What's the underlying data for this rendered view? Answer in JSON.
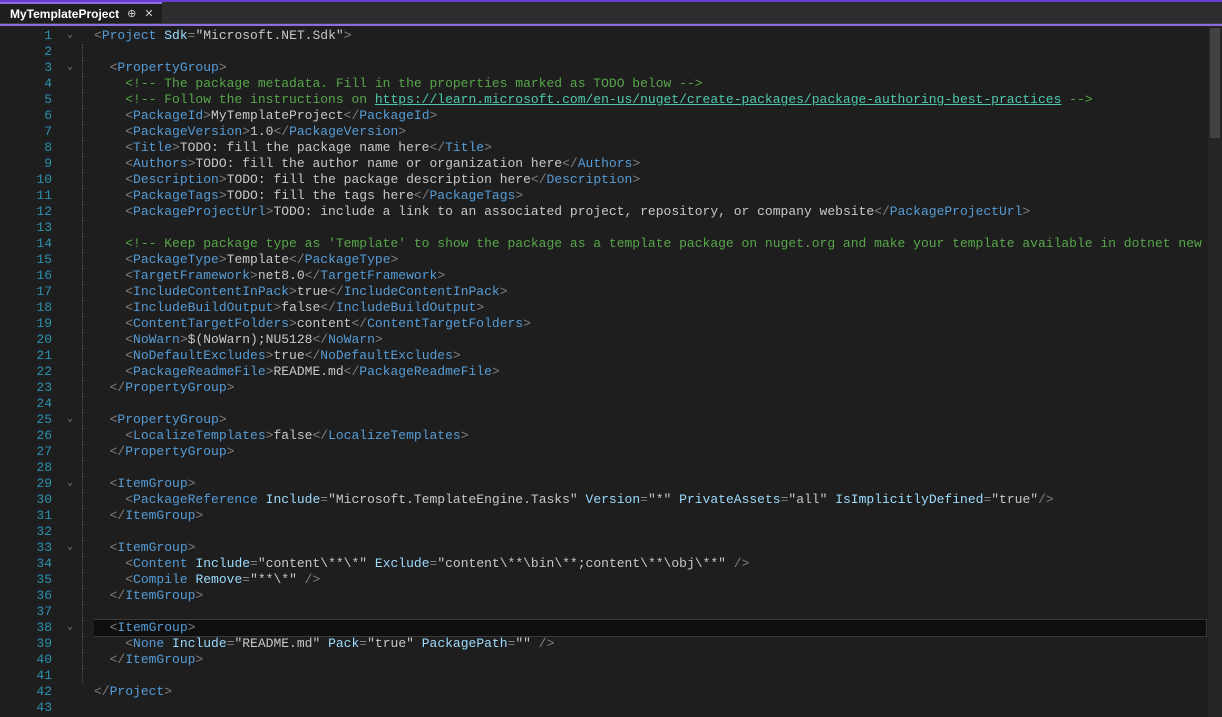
{
  "tab": {
    "title": "MyTemplateProject"
  },
  "line_count": 43,
  "fold": {
    "1": "v",
    "3": "v",
    "25": "v",
    "26": "",
    "29": "v",
    "33": "v",
    "38": "v"
  },
  "highlighted_line": 38,
  "lines": [
    {
      "n": 1,
      "chunks": [
        [
          "p",
          "<"
        ],
        [
          "t",
          "Project "
        ],
        [
          "a",
          "Sdk"
        ],
        [
          "p",
          "="
        ],
        [
          "s",
          "\"Microsoft.NET.Sdk\""
        ],
        [
          "p",
          ">"
        ]
      ]
    },
    {
      "n": 2,
      "chunks": []
    },
    {
      "n": 3,
      "chunks": [
        [
          "p",
          "  <"
        ],
        [
          "t",
          "PropertyGroup"
        ],
        [
          "p",
          ">"
        ]
      ]
    },
    {
      "n": 4,
      "chunks": [
        [
          "p",
          "    "
        ],
        [
          "c",
          "<!-- The package metadata. Fill in the properties marked as TODO below -->"
        ]
      ]
    },
    {
      "n": 5,
      "chunks": [
        [
          "p",
          "    "
        ],
        [
          "c",
          "<!-- Follow the instructions on "
        ],
        [
          "lk",
          "https://learn.microsoft.com/en-us/nuget/create-packages/package-authoring-best-practices"
        ],
        [
          "c",
          " -->"
        ]
      ]
    },
    {
      "n": 6,
      "chunks": [
        [
          "p",
          "    <"
        ],
        [
          "t",
          "PackageId"
        ],
        [
          "p",
          ">"
        ],
        [
          "tx",
          "MyTemplateProject"
        ],
        [
          "p",
          "</"
        ],
        [
          "t",
          "PackageId"
        ],
        [
          "p",
          ">"
        ]
      ]
    },
    {
      "n": 7,
      "chunks": [
        [
          "p",
          "    <"
        ],
        [
          "t",
          "PackageVersion"
        ],
        [
          "p",
          ">"
        ],
        [
          "tx",
          "1.0"
        ],
        [
          "p",
          "</"
        ],
        [
          "t",
          "PackageVersion"
        ],
        [
          "p",
          ">"
        ]
      ]
    },
    {
      "n": 8,
      "chunks": [
        [
          "p",
          "    <"
        ],
        [
          "t",
          "Title"
        ],
        [
          "p",
          ">"
        ],
        [
          "tx",
          "TODO: fill the package name here"
        ],
        [
          "p",
          "</"
        ],
        [
          "t",
          "Title"
        ],
        [
          "p",
          ">"
        ]
      ]
    },
    {
      "n": 9,
      "chunks": [
        [
          "p",
          "    <"
        ],
        [
          "t",
          "Authors"
        ],
        [
          "p",
          ">"
        ],
        [
          "tx",
          "TODO: fill the author name or organization here"
        ],
        [
          "p",
          "</"
        ],
        [
          "t",
          "Authors"
        ],
        [
          "p",
          ">"
        ]
      ]
    },
    {
      "n": 10,
      "chunks": [
        [
          "p",
          "    <"
        ],
        [
          "t",
          "Description"
        ],
        [
          "p",
          ">"
        ],
        [
          "tx",
          "TODO: fill the package description here"
        ],
        [
          "p",
          "</"
        ],
        [
          "t",
          "Description"
        ],
        [
          "p",
          ">"
        ]
      ]
    },
    {
      "n": 11,
      "chunks": [
        [
          "p",
          "    <"
        ],
        [
          "t",
          "PackageTags"
        ],
        [
          "p",
          ">"
        ],
        [
          "tx",
          "TODO: fill the tags here"
        ],
        [
          "p",
          "</"
        ],
        [
          "t",
          "PackageTags"
        ],
        [
          "p",
          ">"
        ]
      ]
    },
    {
      "n": 12,
      "chunks": [
        [
          "p",
          "    <"
        ],
        [
          "t",
          "PackageProjectUrl"
        ],
        [
          "p",
          ">"
        ],
        [
          "tx",
          "TODO: include a link to an associated project, repository, or company website"
        ],
        [
          "p",
          "</"
        ],
        [
          "t",
          "PackageProjectUrl"
        ],
        [
          "p",
          ">"
        ]
      ]
    },
    {
      "n": 13,
      "chunks": []
    },
    {
      "n": 14,
      "chunks": [
        [
          "p",
          "    "
        ],
        [
          "c",
          "<!-- Keep package type as 'Template' to show the package as a template package on nuget.org and make your template available in dotnet new search.-->"
        ]
      ]
    },
    {
      "n": 15,
      "chunks": [
        [
          "p",
          "    <"
        ],
        [
          "t",
          "PackageType"
        ],
        [
          "p",
          ">"
        ],
        [
          "tx",
          "Template"
        ],
        [
          "p",
          "</"
        ],
        [
          "t",
          "PackageType"
        ],
        [
          "p",
          ">"
        ]
      ]
    },
    {
      "n": 16,
      "chunks": [
        [
          "p",
          "    <"
        ],
        [
          "t",
          "TargetFramework"
        ],
        [
          "p",
          ">"
        ],
        [
          "tx",
          "net8.0"
        ],
        [
          "p",
          "</"
        ],
        [
          "t",
          "TargetFramework"
        ],
        [
          "p",
          ">"
        ]
      ]
    },
    {
      "n": 17,
      "chunks": [
        [
          "p",
          "    <"
        ],
        [
          "t",
          "IncludeContentInPack"
        ],
        [
          "p",
          ">"
        ],
        [
          "tx",
          "true"
        ],
        [
          "p",
          "</"
        ],
        [
          "t",
          "IncludeContentInPack"
        ],
        [
          "p",
          ">"
        ]
      ]
    },
    {
      "n": 18,
      "chunks": [
        [
          "p",
          "    <"
        ],
        [
          "t",
          "IncludeBuildOutput"
        ],
        [
          "p",
          ">"
        ],
        [
          "tx",
          "false"
        ],
        [
          "p",
          "</"
        ],
        [
          "t",
          "IncludeBuildOutput"
        ],
        [
          "p",
          ">"
        ]
      ]
    },
    {
      "n": 19,
      "chunks": [
        [
          "p",
          "    <"
        ],
        [
          "t",
          "ContentTargetFolders"
        ],
        [
          "p",
          ">"
        ],
        [
          "tx",
          "content"
        ],
        [
          "p",
          "</"
        ],
        [
          "t",
          "ContentTargetFolders"
        ],
        [
          "p",
          ">"
        ]
      ]
    },
    {
      "n": 20,
      "chunks": [
        [
          "p",
          "    <"
        ],
        [
          "t",
          "NoWarn"
        ],
        [
          "p",
          ">"
        ],
        [
          "tx",
          "$(NoWarn);NU5128"
        ],
        [
          "p",
          "</"
        ],
        [
          "t",
          "NoWarn"
        ],
        [
          "p",
          ">"
        ]
      ]
    },
    {
      "n": 21,
      "chunks": [
        [
          "p",
          "    <"
        ],
        [
          "t",
          "NoDefaultExcludes"
        ],
        [
          "p",
          ">"
        ],
        [
          "tx",
          "true"
        ],
        [
          "p",
          "</"
        ],
        [
          "t",
          "NoDefaultExcludes"
        ],
        [
          "p",
          ">"
        ]
      ]
    },
    {
      "n": 22,
      "chunks": [
        [
          "p",
          "    <"
        ],
        [
          "t",
          "PackageReadmeFile"
        ],
        [
          "p",
          ">"
        ],
        [
          "tx",
          "README.md"
        ],
        [
          "p",
          "</"
        ],
        [
          "t",
          "PackageReadmeFile"
        ],
        [
          "p",
          ">"
        ]
      ]
    },
    {
      "n": 23,
      "chunks": [
        [
          "p",
          "  </"
        ],
        [
          "t",
          "PropertyGroup"
        ],
        [
          "p",
          ">"
        ]
      ]
    },
    {
      "n": 24,
      "chunks": []
    },
    {
      "n": 25,
      "chunks": [
        [
          "p",
          "  <"
        ],
        [
          "t",
          "PropertyGroup"
        ],
        [
          "p",
          ">"
        ]
      ]
    },
    {
      "n": 26,
      "chunks": [
        [
          "p",
          "    <"
        ],
        [
          "t",
          "LocalizeTemplates"
        ],
        [
          "p",
          ">"
        ],
        [
          "tx",
          "false"
        ],
        [
          "p",
          "</"
        ],
        [
          "t",
          "LocalizeTemplates"
        ],
        [
          "p",
          ">"
        ]
      ]
    },
    {
      "n": 27,
      "chunks": [
        [
          "p",
          "  </"
        ],
        [
          "t",
          "PropertyGroup"
        ],
        [
          "p",
          ">"
        ]
      ]
    },
    {
      "n": 28,
      "chunks": []
    },
    {
      "n": 29,
      "chunks": [
        [
          "p",
          "  <"
        ],
        [
          "t",
          "ItemGroup"
        ],
        [
          "p",
          ">"
        ]
      ]
    },
    {
      "n": 30,
      "chunks": [
        [
          "p",
          "    <"
        ],
        [
          "t",
          "PackageReference "
        ],
        [
          "a",
          "Include"
        ],
        [
          "p",
          "="
        ],
        [
          "s",
          "\"Microsoft.TemplateEngine.Tasks\" "
        ],
        [
          "a",
          "Version"
        ],
        [
          "p",
          "="
        ],
        [
          "s",
          "\"*\" "
        ],
        [
          "a",
          "PrivateAssets"
        ],
        [
          "p",
          "="
        ],
        [
          "s",
          "\"all\" "
        ],
        [
          "a",
          "IsImplicitlyDefined"
        ],
        [
          "p",
          "="
        ],
        [
          "s",
          "\"true\""
        ],
        [
          "p",
          "/>"
        ]
      ]
    },
    {
      "n": 31,
      "chunks": [
        [
          "p",
          "  </"
        ],
        [
          "t",
          "ItemGroup"
        ],
        [
          "p",
          ">"
        ]
      ]
    },
    {
      "n": 32,
      "chunks": []
    },
    {
      "n": 33,
      "chunks": [
        [
          "p",
          "  <"
        ],
        [
          "t",
          "ItemGroup"
        ],
        [
          "p",
          ">"
        ]
      ]
    },
    {
      "n": 34,
      "chunks": [
        [
          "p",
          "    <"
        ],
        [
          "t",
          "Content "
        ],
        [
          "a",
          "Include"
        ],
        [
          "p",
          "="
        ],
        [
          "s",
          "\"content\\**\\*\" "
        ],
        [
          "a",
          "Exclude"
        ],
        [
          "p",
          "="
        ],
        [
          "s",
          "\"content\\**\\bin\\**;content\\**\\obj\\**\" "
        ],
        [
          "p",
          "/>"
        ]
      ]
    },
    {
      "n": 35,
      "chunks": [
        [
          "p",
          "    <"
        ],
        [
          "t",
          "Compile "
        ],
        [
          "a",
          "Remove"
        ],
        [
          "p",
          "="
        ],
        [
          "s",
          "\"**\\*\" "
        ],
        [
          "p",
          "/>"
        ]
      ]
    },
    {
      "n": 36,
      "chunks": [
        [
          "p",
          "  </"
        ],
        [
          "t",
          "ItemGroup"
        ],
        [
          "p",
          ">"
        ]
      ]
    },
    {
      "n": 37,
      "chunks": []
    },
    {
      "n": 38,
      "chunks": [
        [
          "p",
          "  <"
        ],
        [
          "t",
          "ItemGroup"
        ],
        [
          "p",
          ">"
        ]
      ]
    },
    {
      "n": 39,
      "chunks": [
        [
          "p",
          "    <"
        ],
        [
          "t",
          "None "
        ],
        [
          "a",
          "Include"
        ],
        [
          "p",
          "="
        ],
        [
          "s",
          "\"README.md\" "
        ],
        [
          "a",
          "Pack"
        ],
        [
          "p",
          "="
        ],
        [
          "s",
          "\"true\" "
        ],
        [
          "a",
          "PackagePath"
        ],
        [
          "p",
          "="
        ],
        [
          "s",
          "\"\" "
        ],
        [
          "p",
          "/>"
        ]
      ]
    },
    {
      "n": 40,
      "chunks": [
        [
          "p",
          "  </"
        ],
        [
          "t",
          "ItemGroup"
        ],
        [
          "p",
          ">"
        ]
      ]
    },
    {
      "n": 41,
      "chunks": []
    },
    {
      "n": 42,
      "chunks": [
        [
          "p",
          "</"
        ],
        [
          "t",
          "Project"
        ],
        [
          "p",
          ">"
        ]
      ]
    },
    {
      "n": 43,
      "chunks": []
    }
  ]
}
